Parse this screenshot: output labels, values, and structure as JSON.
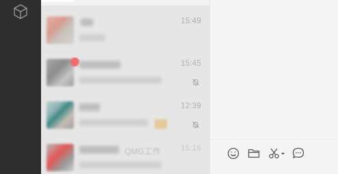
{
  "sidebar": {
    "logo_icon": "cube-icon"
  },
  "chats": [
    {
      "time": "15:49",
      "muted": false
    },
    {
      "time": "15:45",
      "muted": true
    },
    {
      "time": "12:39",
      "muted": true
    },
    {
      "time": "15:16",
      "muted": false,
      "partial_name": "QMG工作"
    }
  ],
  "toolbar": {
    "icons": [
      "emoji-icon",
      "folder-icon",
      "scissors-icon",
      "chat-bubble-icon"
    ]
  },
  "colors": {
    "sidebar": "#2e2e2e",
    "chatlist": "#e6e6e6",
    "content": "#f5f5f5",
    "badge": "#f06d6d",
    "icon": "#555555"
  }
}
